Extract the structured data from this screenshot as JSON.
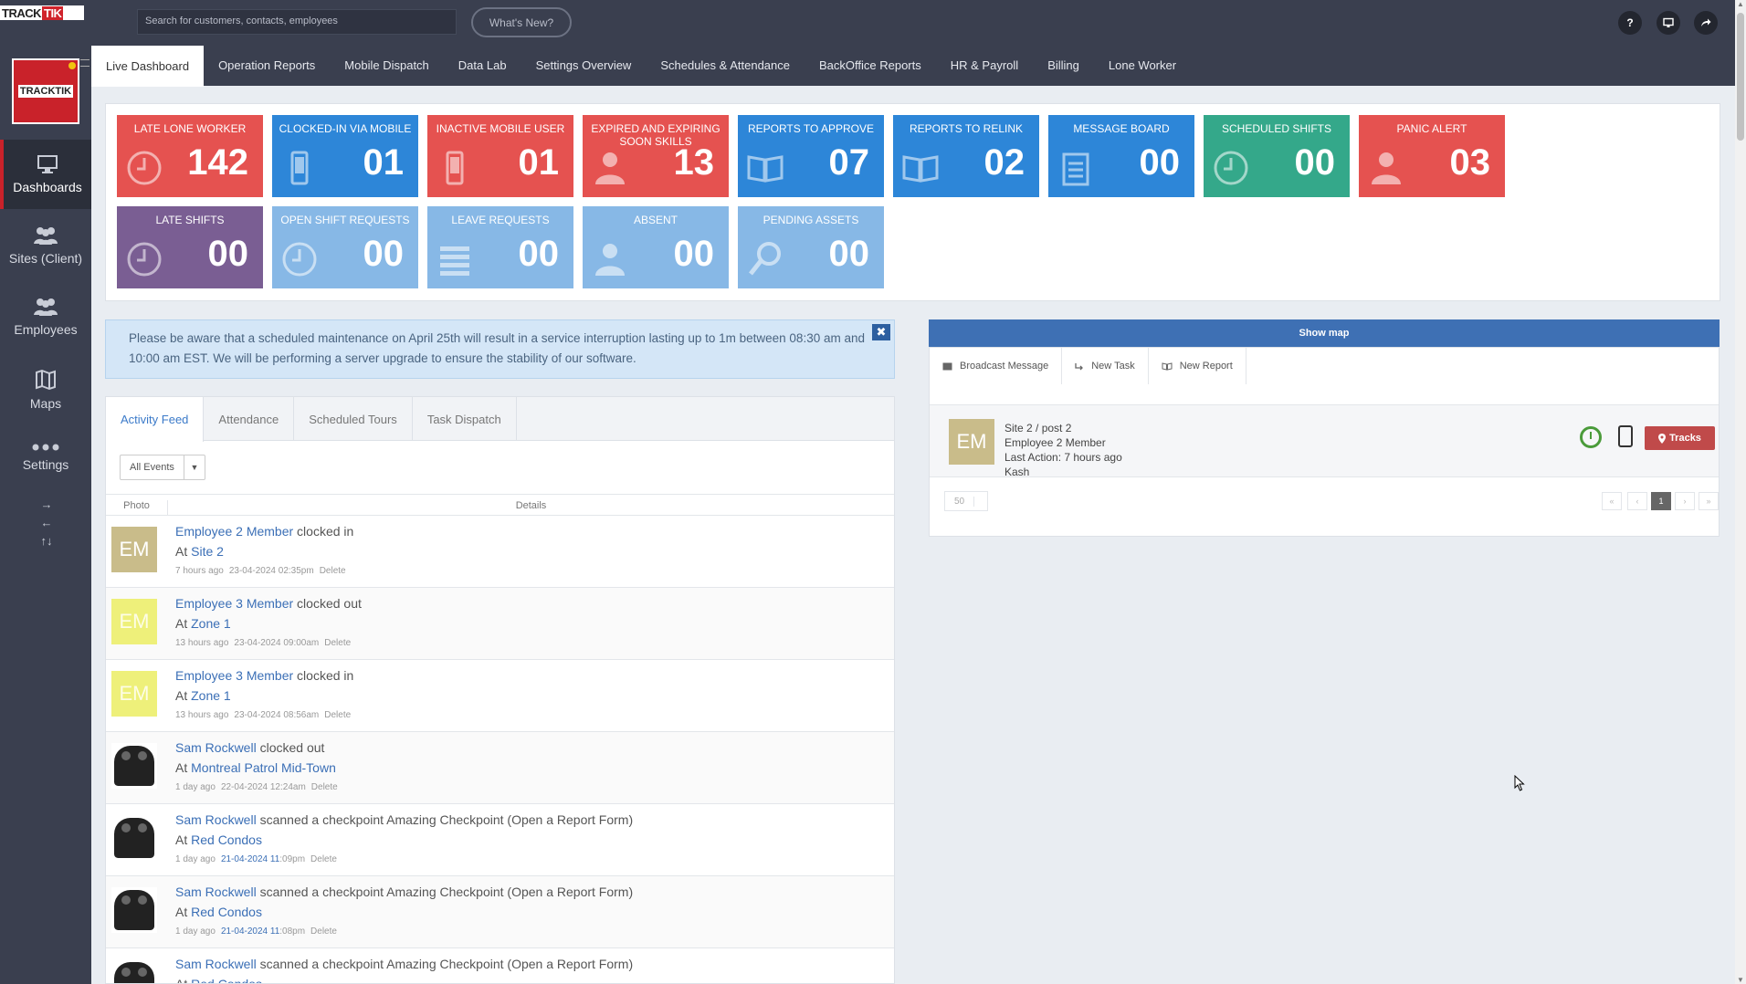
{
  "logo": {
    "part1": "TRACK",
    "part2": "TIK"
  },
  "search": {
    "placeholder": "Search for customers, contacts, employees"
  },
  "whats_new": "What's New?",
  "topbar_icons": {
    "help": "?"
  },
  "sidebar": {
    "items": [
      {
        "label": "Dashboards",
        "icon": "monitor-icon"
      },
      {
        "label": "Sites (Client)",
        "icon": "people-icon"
      },
      {
        "label": "Employees",
        "icon": "people-icon"
      },
      {
        "label": "Maps",
        "icon": "map-icon"
      },
      {
        "label": "Settings",
        "icon": "dots-icon"
      }
    ]
  },
  "tabs": [
    "Live Dashboard",
    "Operation Reports",
    "Mobile Dispatch",
    "Data Lab",
    "Settings Overview",
    "Schedules & Attendance",
    "BackOffice Reports",
    "HR & Payroll",
    "Billing",
    "Lone Worker"
  ],
  "tiles": [
    {
      "title": "Late Lone Worker",
      "value": "142",
      "color": "red",
      "icon": "clock-icon"
    },
    {
      "title": "Clocked-in via mobile",
      "value": "01",
      "color": "blue",
      "icon": "mobile-icon"
    },
    {
      "title": "Inactive Mobile User",
      "value": "01",
      "color": "red",
      "icon": "mobile-icon"
    },
    {
      "title": "Expired and expiring soon skills",
      "value": "13",
      "color": "red",
      "icon": "person-icon"
    },
    {
      "title": "Reports To Approve",
      "value": "07",
      "color": "blue",
      "icon": "book-icon"
    },
    {
      "title": "Reports To Relink",
      "value": "02",
      "color": "blue",
      "icon": "book-icon"
    },
    {
      "title": "Message Board",
      "value": "00",
      "color": "blue",
      "icon": "clipboard-icon"
    },
    {
      "title": "Scheduled Shifts",
      "value": "00",
      "color": "green",
      "icon": "clock-icon"
    },
    {
      "title": "Panic Alert",
      "value": "03",
      "color": "red",
      "icon": "person-icon"
    },
    {
      "title": "Late Shifts",
      "value": "00",
      "color": "purple",
      "icon": "clock-icon"
    },
    {
      "title": "Open Shift Requests",
      "value": "00",
      "color": "lblue",
      "icon": "clock-icon"
    },
    {
      "title": "Leave Requests",
      "value": "00",
      "color": "lblue",
      "icon": "list-icon"
    },
    {
      "title": "Absent",
      "value": "00",
      "color": "lblue",
      "icon": "person-icon"
    },
    {
      "title": "Pending Assets",
      "value": "00",
      "color": "lblue",
      "icon": "link-icon"
    }
  ],
  "notice": {
    "text": "Please be aware that a scheduled maintenance on April 25th will result in a service interruption lasting up to 1m between 08:30 am and 10:00 am EST. We will be performing a server upgrade to ensure the stability of our software.",
    "close": "✖"
  },
  "feed": {
    "tabs": [
      "Activity Feed",
      "Attendance",
      "Scheduled Tours",
      "Task Dispatch"
    ],
    "filter": "All Events",
    "headers": {
      "photo": "Photo",
      "details": "Details"
    },
    "rows": [
      {
        "avatar": "EM",
        "avatar_style": "tan",
        "name": "Employee 2 Member",
        "action": " clocked in",
        "at": "At ",
        "place": "Site 2",
        "ago": "7 hours ago",
        "date": "23-04-2024 02:35pm",
        "date_hl": "",
        "delete": "Delete"
      },
      {
        "avatar": "EM",
        "avatar_style": "yel",
        "name": "Employee 3 Member",
        "action": " clocked out",
        "at": "At ",
        "place": "Zone 1",
        "ago": "13 hours ago",
        "date": "23-04-2024 09:00am",
        "date_hl": "",
        "delete": "Delete"
      },
      {
        "avatar": "EM",
        "avatar_style": "yel",
        "name": "Employee 3 Member",
        "action": " clocked in",
        "at": "At ",
        "place": "Zone 1",
        "ago": "13 hours ago",
        "date": "23-04-2024 08:56am",
        "date_hl": "",
        "delete": "Delete"
      },
      {
        "avatar": "",
        "avatar_style": "photo",
        "name": "Sam Rockwell",
        "action": " clocked out",
        "at": "At ",
        "place": "Montreal Patrol Mid-Town",
        "ago": "1 day ago",
        "date": "22-04-2024 12:24am",
        "date_hl": "",
        "delete": "Delete"
      },
      {
        "avatar": "",
        "avatar_style": "photo",
        "name": "Sam Rockwell",
        "action": " scanned a checkpoint Amazing Checkpoint (Open a Report Form)",
        "at": "At ",
        "place": "Red Condos",
        "ago": "1 day ago",
        "date_hl": "21-04-2024 11",
        "date": ":09pm",
        "delete": "Delete"
      },
      {
        "avatar": "",
        "avatar_style": "photo",
        "name": "Sam Rockwell",
        "action": " scanned a checkpoint Amazing Checkpoint (Open a Report Form)",
        "at": "At ",
        "place": "Red Condos",
        "ago": "1 day ago",
        "date_hl": "21-04-2024 11",
        "date": ":08pm",
        "delete": "Delete"
      },
      {
        "avatar": "",
        "avatar_style": "photo",
        "name": "Sam Rockwell",
        "action": " scanned a checkpoint Amazing Checkpoint (Open a Report Form)",
        "at": "At ",
        "place": "Red Condos",
        "ago": "",
        "date_hl": "",
        "date": "",
        "delete": ""
      }
    ]
  },
  "map_bar": "Show map",
  "right_actions": [
    {
      "label": "Broadcast Message",
      "icon": "message-icon"
    },
    {
      "label": "New Task",
      "icon": "task-icon"
    },
    {
      "label": "New Report",
      "icon": "book-icon"
    }
  ],
  "right_card": {
    "avatar": "EM",
    "line1": "Site 2 / post 2",
    "line2": "Employee 2 Member",
    "line3": "Last Action: 7 hours ago",
    "line4": "Kash",
    "tracks": "Tracks"
  },
  "pager": {
    "size": "50",
    "first": "«",
    "prev": "‹",
    "current": "1",
    "next": "›",
    "last": "»"
  },
  "colors": {
    "red": "#e55250",
    "blue": "#2d86d8",
    "green": "#34a88a",
    "purple": "#7a5e93",
    "lblue": "#87b8e6"
  }
}
